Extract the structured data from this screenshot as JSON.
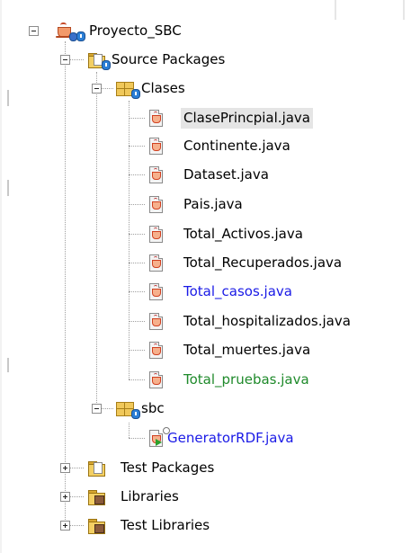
{
  "tree": {
    "project": {
      "label": "Proyecto_SBC",
      "icon": "java-project-icon"
    },
    "source_packages": {
      "label": "Source Packages",
      "icon": "source-folder-icon"
    },
    "packages": [
      {
        "label": "Clases",
        "icon": "package-icon",
        "files": [
          {
            "label": "ClasePrincpial.java",
            "selected": true,
            "status": "normal"
          },
          {
            "label": "Continente.java",
            "status": "normal"
          },
          {
            "label": "Dataset.java",
            "status": "normal"
          },
          {
            "label": "Pais.java",
            "status": "normal"
          },
          {
            "label": "Total_Activos.java",
            "status": "normal"
          },
          {
            "label": "Total_Recuperados.java",
            "status": "normal"
          },
          {
            "label": "Total_casos.java",
            "status": "modified"
          },
          {
            "label": "Total_hospitalizados.java",
            "status": "normal"
          },
          {
            "label": "Total_muertes.java",
            "status": "normal"
          },
          {
            "label": "Total_pruebas.java",
            "status": "new"
          }
        ]
      },
      {
        "label": "sbc",
        "icon": "package-icon",
        "files": [
          {
            "label": "GeneratorRDF.java",
            "status": "modified",
            "main_class": true
          }
        ]
      }
    ],
    "other_nodes": [
      {
        "label": "Test Packages",
        "icon": "test-folder-icon"
      },
      {
        "label": "Libraries",
        "icon": "libraries-icon"
      },
      {
        "label": "Test Libraries",
        "icon": "test-libraries-icon"
      }
    ]
  },
  "colors": {
    "modified": "#1a1ae6",
    "new": "#1f8a2b",
    "selection": "#e5e5e5",
    "tree_lines": "#a0a0a0"
  }
}
